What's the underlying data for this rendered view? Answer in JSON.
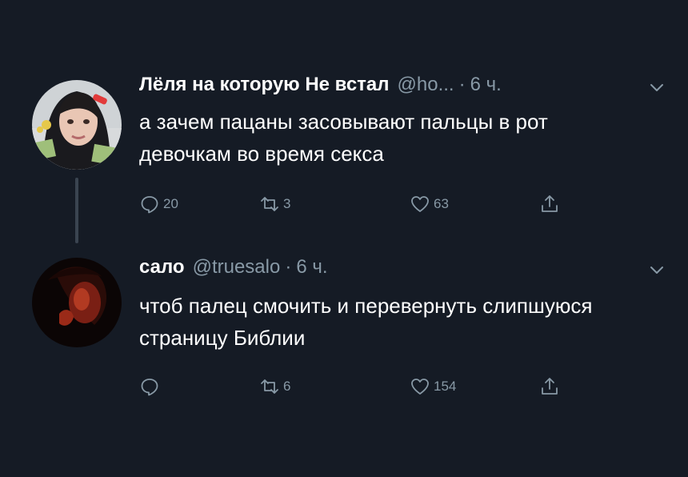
{
  "tweets": [
    {
      "display_name": "Лёля на которую Не встал",
      "handle": "@ho...",
      "separator": "·",
      "time": "6 ч.",
      "text": "а зачем пацаны засовывают пальцы в рот девочкам во время секса",
      "replies": "20",
      "retweets": "3",
      "likes": "63"
    },
    {
      "display_name": "сало",
      "handle": "@truesalo",
      "separator": "·",
      "time": "6 ч.",
      "text": "чтоб палец смочить и перевернуть слипшуюся страницу Библии",
      "replies": "",
      "retweets": "6",
      "likes": "154"
    }
  ],
  "colors": {
    "background": "#151b25",
    "secondary_text": "#8899a6",
    "thread_line": "#3a4450"
  },
  "icons": [
    "reply-icon",
    "retweet-icon",
    "like-icon",
    "share-icon",
    "chevron-down-icon"
  ]
}
